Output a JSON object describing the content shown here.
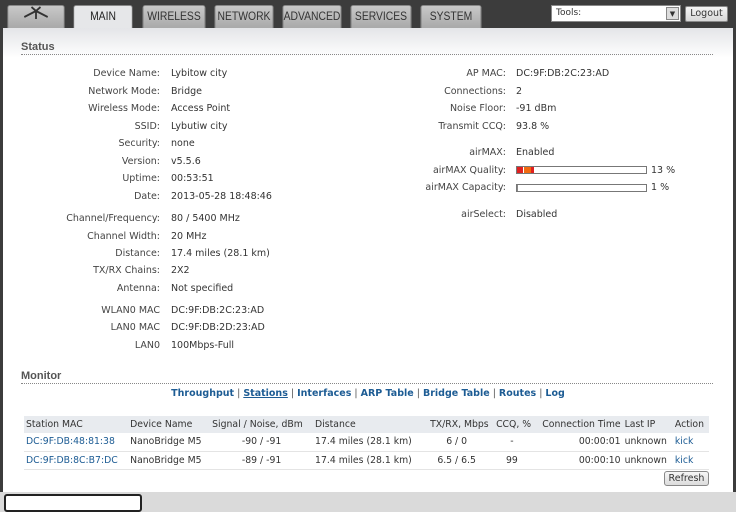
{
  "tabs": [
    "MAIN",
    "WIRELESS",
    "NETWORK",
    "ADVANCED",
    "SERVICES",
    "SYSTEM"
  ],
  "tools_select": "Tools:",
  "logout": "Logout",
  "status": {
    "title": "Status",
    "left": [
      {
        "label": "Device Name:",
        "value": "Lybitow city"
      },
      {
        "label": "Network Mode:",
        "value": "Bridge"
      },
      {
        "label": "Wireless Mode:",
        "value": "Access Point"
      },
      {
        "label": "SSID:",
        "value": "Lybutiw city"
      },
      {
        "label": "Security:",
        "value": "none"
      },
      {
        "label": "Version:",
        "value": "v5.5.6"
      },
      {
        "label": "Uptime:",
        "value": "00:53:51"
      },
      {
        "label": "Date:",
        "value": "2013-05-28 18:48:46"
      },
      {
        "label": "Channel/Frequency:",
        "value": "80 / 5400 MHz"
      },
      {
        "label": "Channel Width:",
        "value": "20 MHz"
      },
      {
        "label": "Distance:",
        "value": "17.4 miles (28.1 km)"
      },
      {
        "label": "TX/RX Chains:",
        "value": "2X2"
      },
      {
        "label": "Antenna:",
        "value": "Not specified"
      },
      {
        "label": "WLAN0 MAC",
        "value": "DC:9F:DB:2C:23:AD"
      },
      {
        "label": "LAN0 MAC",
        "value": "DC:9F:DB:2D:23:AD"
      },
      {
        "label": "LAN0",
        "value": "100Mbps-Full"
      }
    ],
    "right": [
      {
        "label": "AP MAC:",
        "value": "DC:9F:DB:2C:23:AD"
      },
      {
        "label": "Connections:",
        "value": "2"
      },
      {
        "label": "Noise Floor:",
        "value": "-91 dBm"
      },
      {
        "label": "Transmit CCQ:",
        "value": "93.8 %"
      },
      {
        "label": "airMAX:",
        "value": "Enabled"
      },
      {
        "label": "airMAX Quality:",
        "value": "13 %",
        "percent": 13
      },
      {
        "label": "airMAX Capacity:",
        "value": "1 %",
        "percent": 1
      },
      {
        "label": "airSelect:",
        "value": "Disabled"
      }
    ]
  },
  "monitor": {
    "title": "Monitor",
    "links": [
      "Throughput",
      "Stations",
      "Interfaces",
      "ARP Table",
      "Bridge Table",
      "Routes",
      "Log"
    ],
    "columns": [
      "Station MAC",
      "Device Name",
      "Signal / Noise, dBm",
      "Distance",
      "TX/RX, Mbps",
      "CCQ, %",
      "Connection Time",
      "Last IP",
      "Action"
    ],
    "rows": [
      [
        "DC:9F:DB:48:81:38",
        "NanoBridge M5",
        "-90 / -91",
        "17.4 miles (28.1 km)",
        "6 / 0",
        "-",
        "00:00:01",
        "unknown",
        "kick"
      ],
      [
        "DC:9F:DB:8C:B7:DC",
        "NanoBridge M5",
        "-89 / -91",
        "17.4 miles (28.1 km)",
        "6.5 / 6.5",
        "99",
        "00:00:10",
        "unknown",
        "kick"
      ]
    ],
    "refresh": "Refresh"
  }
}
